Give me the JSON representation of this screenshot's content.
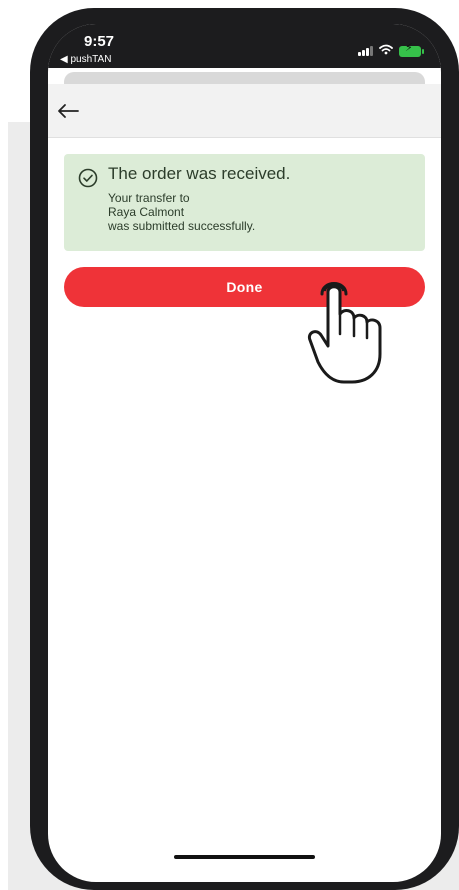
{
  "status_bar": {
    "time": "9:57",
    "back_to_app": "◀ pushTAN",
    "icons": [
      "signal-icon",
      "wifi-icon",
      "battery-charging-icon"
    ]
  },
  "nav": {
    "back_icon": "arrow-left-icon"
  },
  "success": {
    "icon": "check-circle-icon",
    "title": "The order was received.",
    "line1": "Your transfer to",
    "line2": "Raya Calmont",
    "line3": "was submitted successfully.",
    "background_color": "#dcecd7"
  },
  "actions": {
    "done_label": "Done",
    "done_color": "#ef3338"
  },
  "overlay": {
    "icon": "tap-hand-icon"
  }
}
